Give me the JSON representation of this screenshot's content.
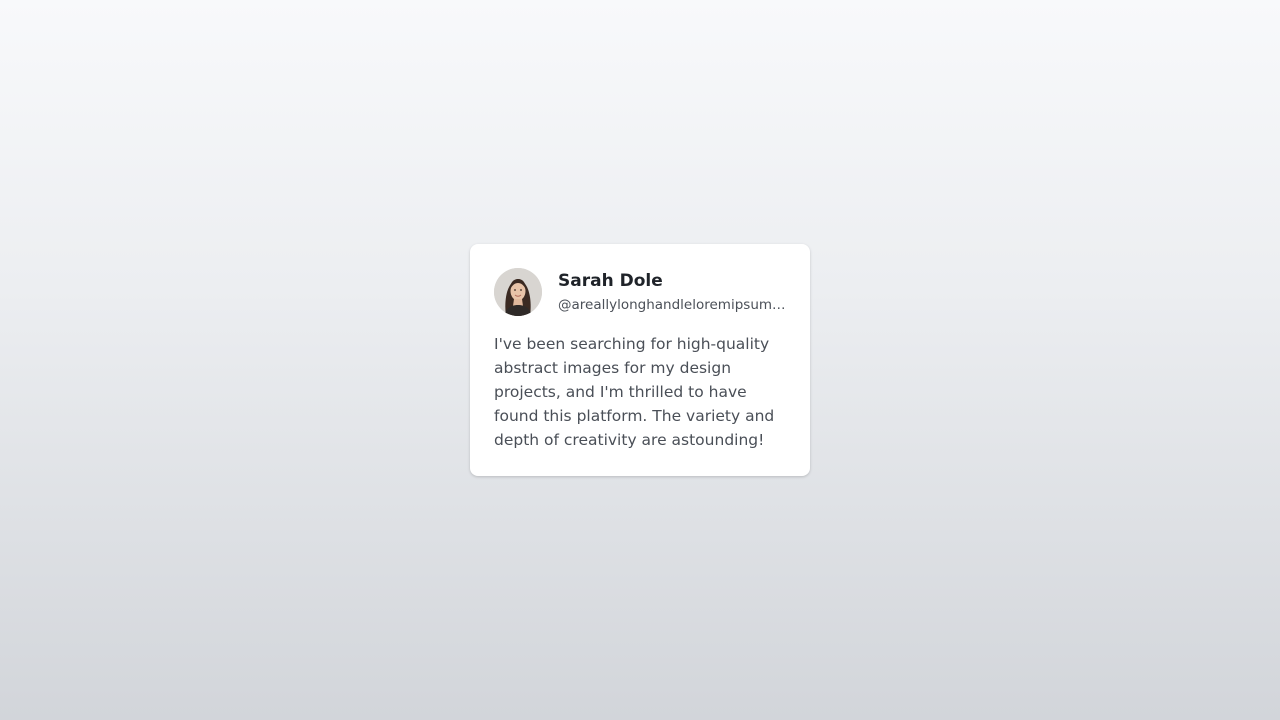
{
  "testimonial": {
    "name": "Sarah Dole",
    "handle": "@areallylonghandleloremipsumdolorsitamet",
    "quote": "I've been searching for high-quality abstract images for my design projects, and I'm thrilled to have found this platform. The variety and depth of creativity are astounding!"
  },
  "colors": {
    "card_background": "#ffffff",
    "name_text": "#1f2329",
    "secondary_text": "#4b5058",
    "background_top": "#f8f9fb",
    "background_bottom": "#d2d5da"
  }
}
